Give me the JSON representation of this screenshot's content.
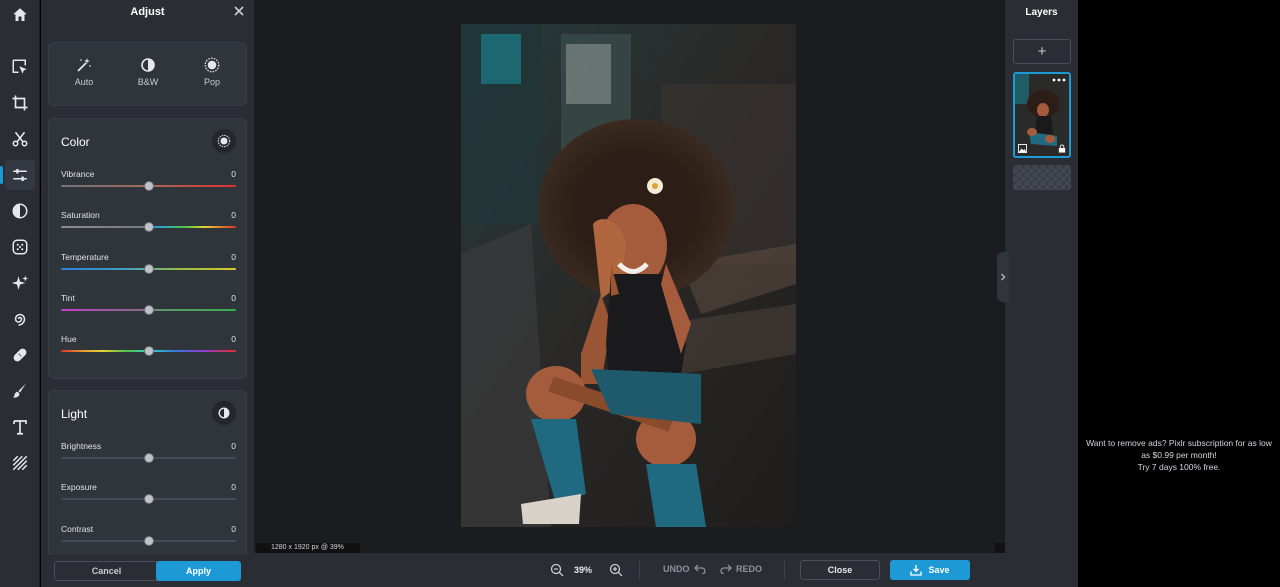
{
  "toolbar": {
    "tools": [
      {
        "icon": "home-icon"
      },
      {
        "icon": "arrange-select-icon"
      },
      {
        "icon": "crop-icon"
      },
      {
        "icon": "cutout-scissors-icon"
      },
      {
        "icon": "adjust-sliders-icon",
        "active": true
      },
      {
        "icon": "filter-half-circle-icon"
      },
      {
        "icon": "effect-dots-icon"
      },
      {
        "icon": "sparkle-icon"
      },
      {
        "icon": "liquify-swirl-icon"
      },
      {
        "icon": "heal-bandage-icon"
      },
      {
        "icon": "brush-icon"
      },
      {
        "icon": "text-icon"
      },
      {
        "icon": "pattern-lines-icon"
      }
    ]
  },
  "adjust_panel": {
    "title": "Adjust",
    "presets": [
      {
        "label": "Auto",
        "icon": "magic-wand-icon"
      },
      {
        "label": "B&W",
        "icon": "half-circle-icon"
      },
      {
        "label": "Pop",
        "icon": "burst-icon"
      }
    ],
    "color": {
      "title": "Color",
      "sliders": [
        {
          "label": "Vibrance",
          "value": "0"
        },
        {
          "label": "Saturation",
          "value": "0"
        },
        {
          "label": "Temperature",
          "value": "0"
        },
        {
          "label": "Tint",
          "value": "0"
        },
        {
          "label": "Hue",
          "value": "0"
        }
      ]
    },
    "light": {
      "title": "Light",
      "sliders": [
        {
          "label": "Brightness",
          "value": "0"
        },
        {
          "label": "Exposure",
          "value": "0"
        },
        {
          "label": "Contrast",
          "value": "0"
        }
      ]
    },
    "cancel_label": "Cancel",
    "apply_label": "Apply"
  },
  "canvas": {
    "info": "1280 x 1920 px @ 39%"
  },
  "bottom_bar": {
    "zoom": "39%",
    "undo_label": "UNDO",
    "redo_label": "REDO",
    "close_label": "Close",
    "save_label": "Save"
  },
  "layers": {
    "title": "Layers",
    "add_label": "+"
  },
  "ad": {
    "line1": "Want to remove ads? Pixlr subscription for as low as $0.99 per month!",
    "line2": "Try 7 days 100% free."
  },
  "colors": {
    "accent": "#1d9ad6",
    "panel": "#2a2d33",
    "canvas": "#1b1c1f"
  }
}
